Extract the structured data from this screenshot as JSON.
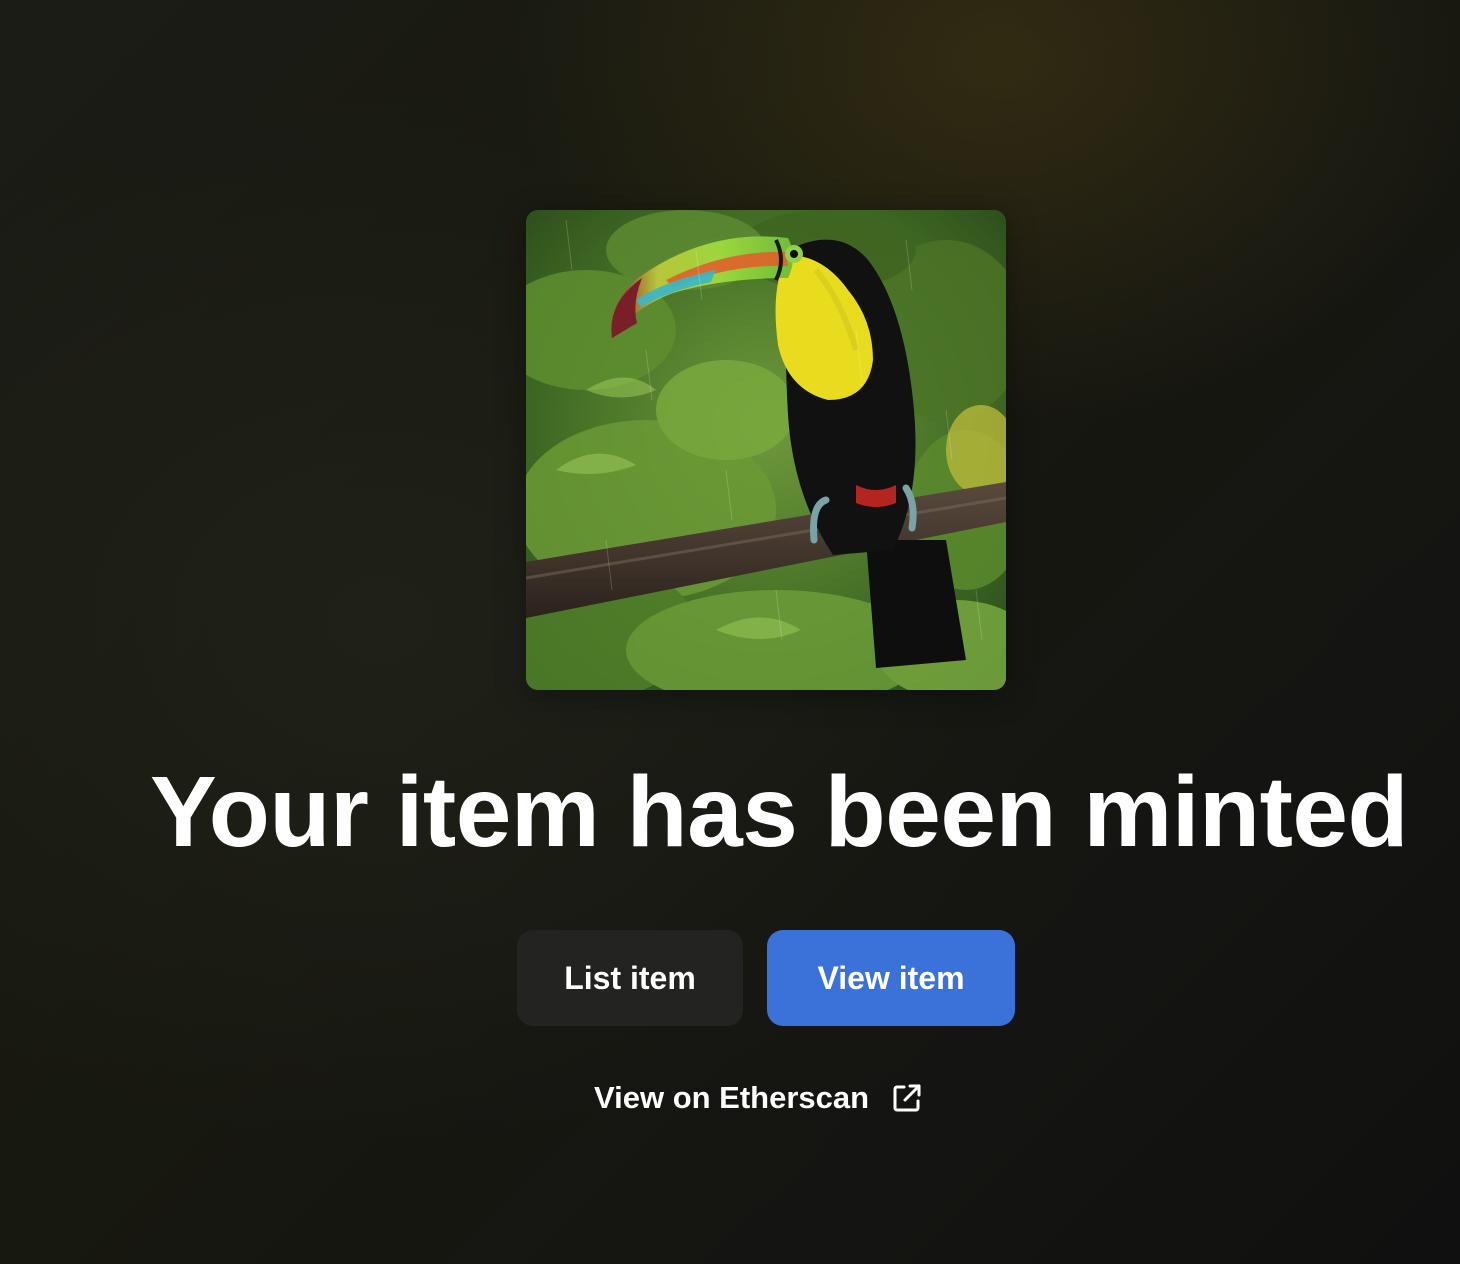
{
  "headline": "Your item has been minted",
  "artwork": {
    "alt": "Keel-billed toucan perched on a branch"
  },
  "actions": {
    "list_label": "List item",
    "view_label": "View item",
    "etherscan_label": "View on Etherscan"
  },
  "icons": {
    "external_link": "external-link-icon"
  },
  "colors": {
    "primary": "#3a72d9",
    "secondary": "#232321",
    "text": "#ffffff",
    "background": "#171812"
  }
}
